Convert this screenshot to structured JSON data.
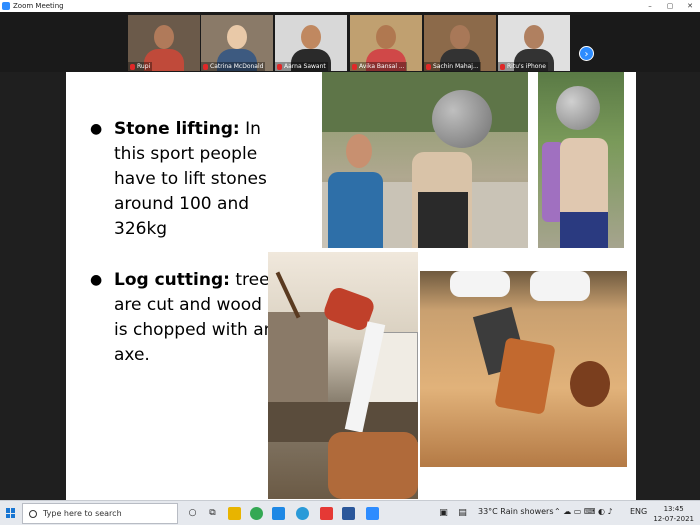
{
  "window": {
    "title": "Zoom Meeting",
    "controls": [
      "–",
      "▢",
      "✕"
    ]
  },
  "participants": [
    {
      "name": "Rupi",
      "bg": "#6b5a4a",
      "skin": "#b07a5a",
      "shirt": "#c04a3a"
    },
    {
      "name": "Catrina McDonald",
      "bg": "#8a7a68",
      "skin": "#e9c9a8",
      "shirt": "#3d5a80"
    },
    {
      "name": "Aarna Sawant",
      "bg": "#d8d8d8",
      "skin": "#c08860",
      "shirt": "#2a2a2a"
    },
    {
      "name": "Avika Bansal ...",
      "bg": "#c0a070",
      "skin": "#b07850",
      "shirt": "#d04848"
    },
    {
      "name": "Sachin Mahaj...",
      "bg": "#8c6a4a",
      "skin": "#a87858",
      "shirt": "#333"
    },
    {
      "name": "Ritu's iPhone",
      "bg": "#e0e0e0",
      "skin": "#b08060",
      "shirt": "#333"
    }
  ],
  "gallery_next": "›",
  "slide": {
    "bullet1": {
      "heading": "Stone lifting:",
      "text": "In this sport people have to lift stones around 100 and 326kg"
    },
    "bullet2": {
      "heading": "Log cutting:",
      "text": "trees are cut and wood is chopped with an axe."
    }
  },
  "taskbar": {
    "search_placeholder": "Type here to search",
    "weather": "33°C  Rain showers",
    "language": "ENG",
    "time": "13:45",
    "date": "12-07-2021"
  }
}
